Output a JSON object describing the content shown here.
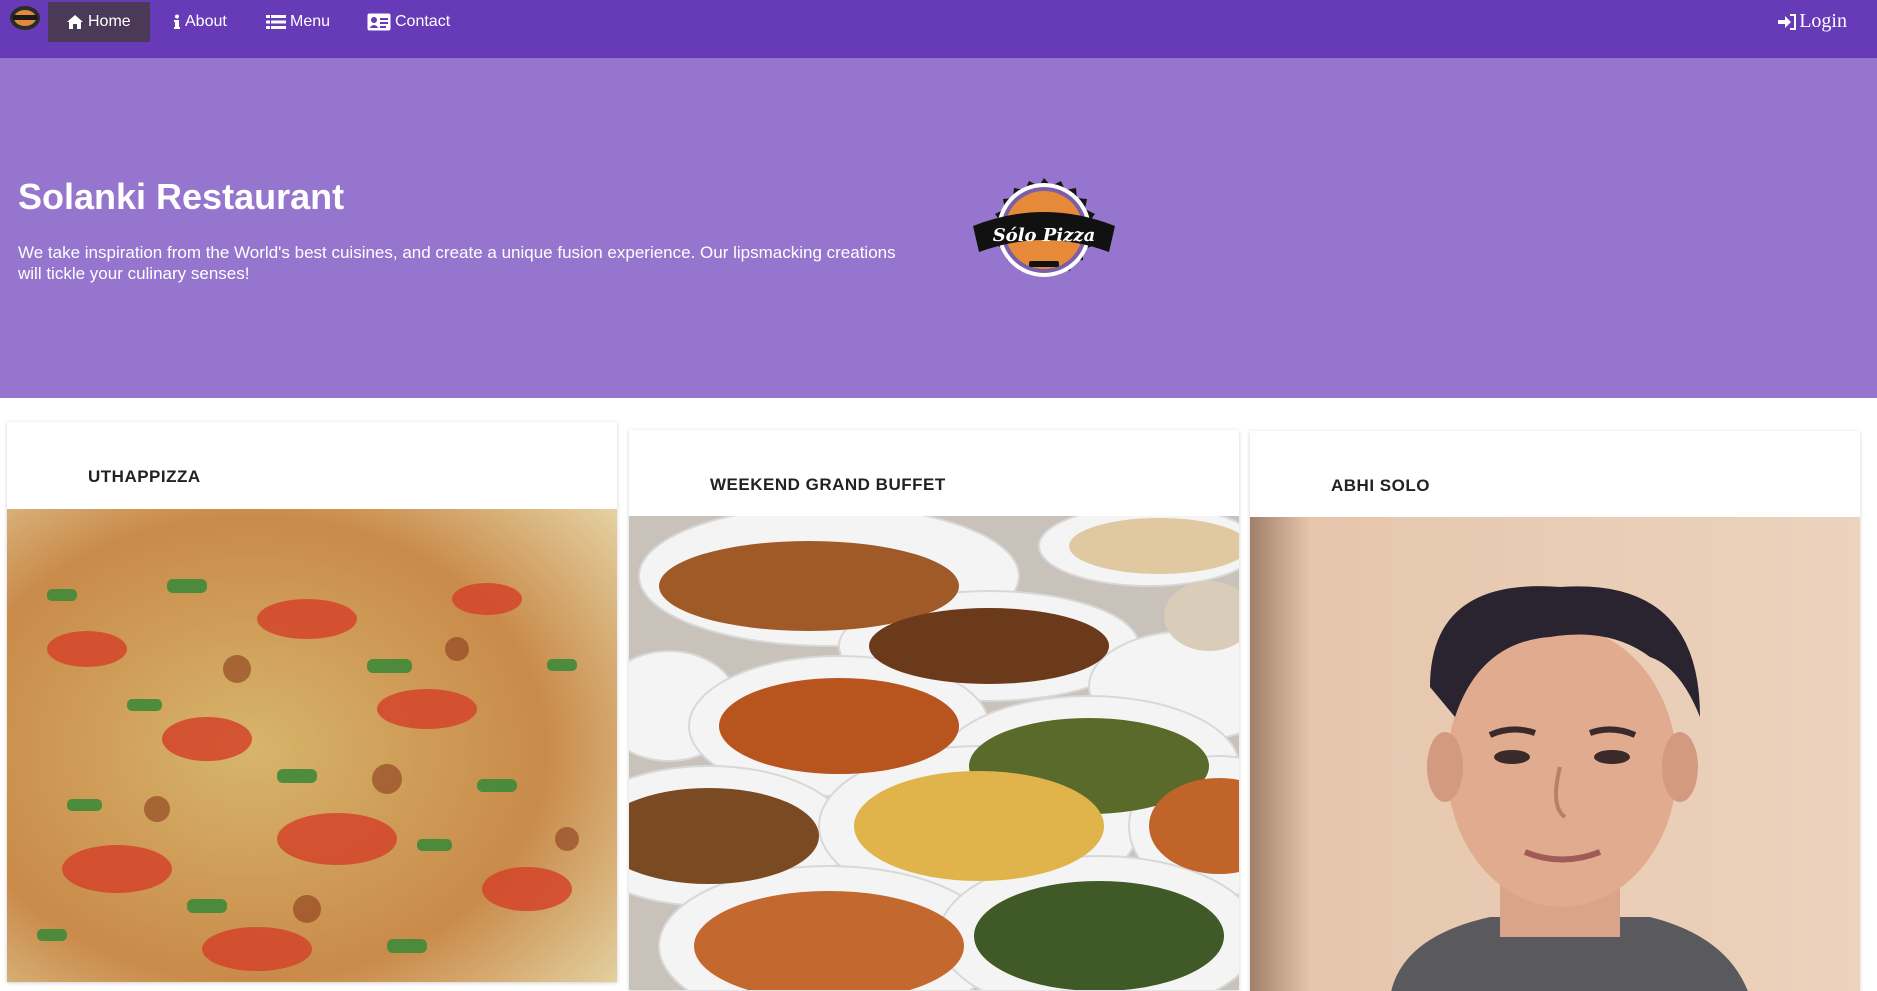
{
  "nav": {
    "brand_icon": "pizza-logo-icon",
    "items": [
      {
        "label": "Home",
        "icon": "home-icon",
        "active": true
      },
      {
        "label": "About",
        "icon": "info-icon"
      },
      {
        "label": "Menu",
        "icon": "list-icon"
      },
      {
        "label": "Contact",
        "icon": "address-card-icon"
      }
    ],
    "login_label": "Login",
    "login_icon": "sign-in-icon"
  },
  "hero": {
    "title": "Solanki Restaurant",
    "description": "We take inspiration from the World's best cuisines, and create a unique fusion experience. Our lipsmacking creations will tickle your culinary senses!",
    "logo_text": "Sólo Pizza"
  },
  "cards": [
    {
      "title": "UTHAPPIZZA",
      "image": "pizza-photo"
    },
    {
      "title": "WEEKEND GRAND BUFFET",
      "image": "buffet-photo"
    },
    {
      "title": "ABHI SOLO",
      "image": "person-photo"
    }
  ],
  "colors": {
    "navbar": "#673ab7",
    "hero": "#9575cd",
    "active_nav": "#4a3a57"
  }
}
